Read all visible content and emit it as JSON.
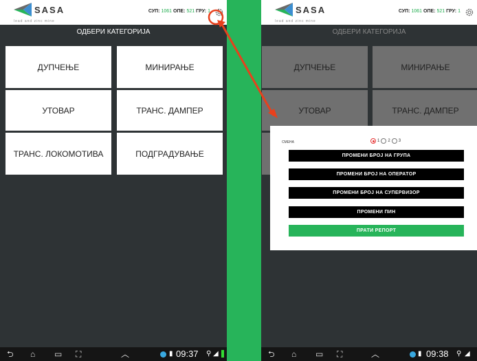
{
  "left": {
    "app": {
      "logo_text": "SASA",
      "logo_sub": "lead and zinc mine"
    },
    "stats": {
      "sup_label": "СУП:",
      "sup_value": "1061",
      "ope_label": "ОПЕ:",
      "ope_value": "521",
      "gru_label": "ГРУ:",
      "gru_value": "1"
    },
    "header": "ОДБЕРИ КАТЕГОРИЈА",
    "tiles": [
      "ДУПЧЕЊЕ",
      "МИНИРАЊЕ",
      "УТОВАР",
      "ТРАНС. ДАМПЕР",
      "ТРАНС. ЛОКОМОТИВА",
      "ПОДГРАДУВАЊЕ"
    ],
    "time": "09:37"
  },
  "right": {
    "app": {
      "logo_text": "SASA",
      "logo_sub": "lead and zinc mine"
    },
    "stats": {
      "sup_label": "СУП:",
      "sup_value": "1061",
      "ope_label": "ОПЕ:",
      "ope_value": "521",
      "gru_label": "ГРУ:",
      "gru_value": "1"
    },
    "header": "ОДБЕРИ КАТЕГОРИЈА",
    "tiles": [
      "ДУПЧЕЊЕ",
      "МИНИРАЊЕ",
      "УТОВАР",
      "ТРАНС. ДАМПЕР"
    ],
    "dialog": {
      "shift_label": "СМЕНА",
      "shifts": [
        "1",
        "2",
        "3"
      ],
      "selected_shift": "1",
      "buttons": [
        "ПРОМЕНИ БРОЈ НА ГРУПА",
        "ПРОМЕНИ БРОЈ НА ОПЕРАТОР",
        "ПРОМЕНИ БРОЈ НА СУПЕРВИЗОР",
        "ПРОМЕНИ ПИН"
      ],
      "submit": "ПРАТИ РЕПОРТ"
    },
    "time": "09:38"
  },
  "colors": {
    "accent_green": "#27b45a",
    "panel": "#2e3335",
    "annotation": "#e8401c"
  },
  "icons": [
    "gear-icon",
    "back-icon",
    "home-icon",
    "recent-apps-icon",
    "screenshot-icon",
    "up-chevron-icon",
    "wifi-icon",
    "battery-icon"
  ]
}
